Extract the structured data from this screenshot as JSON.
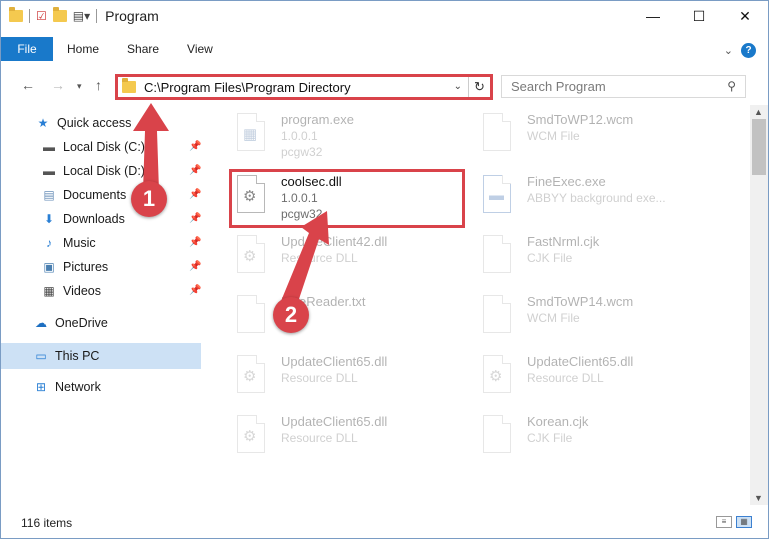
{
  "window": {
    "title": "Program",
    "controls": {
      "minimize": "—",
      "maximize": "☐",
      "close": "✕"
    }
  },
  "ribbon": {
    "tabs": [
      "File",
      "Home",
      "Share",
      "View"
    ],
    "help": "?"
  },
  "address": {
    "path": "C:\\Program Files\\Program Directory",
    "search_placeholder": "Search Program"
  },
  "sidebar": {
    "items": [
      {
        "label": "Quick access",
        "icon": "star-icon",
        "pinned": false
      },
      {
        "label": "Local Disk (C:)",
        "icon": "drive-icon",
        "pinned": true
      },
      {
        "label": "Local Disk (D:)",
        "icon": "drive-icon",
        "pinned": true
      },
      {
        "label": "Documents",
        "icon": "documents-icon",
        "pinned": true
      },
      {
        "label": "Downloads",
        "icon": "download-icon",
        "pinned": true
      },
      {
        "label": "Music",
        "icon": "music-icon",
        "pinned": true
      },
      {
        "label": "Pictures",
        "icon": "pictures-icon",
        "pinned": true
      },
      {
        "label": "Videos",
        "icon": "videos-icon",
        "pinned": true
      },
      {
        "label": "OneDrive",
        "icon": "cloud-icon",
        "pinned": false
      },
      {
        "label": "This PC",
        "icon": "computer-icon",
        "pinned": false,
        "selected": true
      },
      {
        "label": "Network",
        "icon": "network-icon",
        "pinned": false
      }
    ]
  },
  "files": [
    {
      "name": "program.exe",
      "line2": "1.0.0.1",
      "line3": "pcgw32",
      "faded": true
    },
    {
      "name": "SmdToWP12.wcm",
      "line2": "WCM File",
      "line3": "",
      "faded": true
    },
    {
      "name": "coolsec.dll",
      "line2": "1.0.0.1",
      "line3": "pcgw32",
      "faded": false,
      "highlighted": true
    },
    {
      "name": "FineExec.exe",
      "line2": "ABBYY background exe...",
      "line3": "",
      "faded": true
    },
    {
      "name": "UpdateClient42.dll",
      "line2": "Resource DLL",
      "line3": "",
      "faded": true
    },
    {
      "name": "FastNrml.cjk",
      "line2": "CJK File",
      "line3": "",
      "faded": true
    },
    {
      "name": "FineReader.txt",
      "line2": "",
      "line3": "",
      "faded": true
    },
    {
      "name": "SmdToWP14.wcm",
      "line2": "WCM File",
      "line3": "",
      "faded": true
    },
    {
      "name": "UpdateClient65.dll",
      "line2": "Resource DLL",
      "line3": "",
      "faded": true
    },
    {
      "name": "UpdateClient65.dll",
      "line2": "Resource DLL",
      "line3": "",
      "faded": true
    },
    {
      "name": "UpdateClient65.dll",
      "line2": "Resource DLL",
      "line3": "",
      "faded": true
    },
    {
      "name": "Korean.cjk",
      "line2": "CJK File",
      "line3": "",
      "faded": true
    }
  ],
  "status": {
    "count": "116 items"
  },
  "callouts": [
    "1",
    "2"
  ],
  "colors": {
    "accent": "#1979ca",
    "callout": "#d9434a",
    "selection": "#cde1f5"
  }
}
